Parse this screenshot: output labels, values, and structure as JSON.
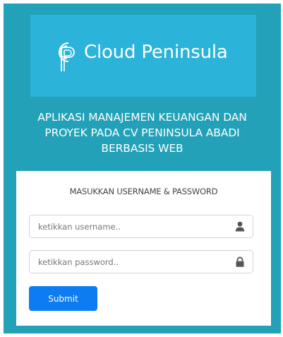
{
  "logo": {
    "brand_name": "Cloud Peninsula",
    "mark_icon": "cloud-peninsula-logo-icon"
  },
  "app_title": {
    "line1": "APLIKASI MANAJEMEN KEUANGAN DAN",
    "line2": "PROYEK PADA CV PENINSULA ABADI",
    "line3": "BERBASIS WEB"
  },
  "login": {
    "heading": "MASUKKAN USERNAME & PASSWORD",
    "username": {
      "value": "",
      "placeholder": "ketikkan username..",
      "icon": "user-icon"
    },
    "password": {
      "value": "",
      "placeholder": "ketikkan password..",
      "icon": "lock-icon"
    },
    "submit_label": "Submit"
  },
  "colors": {
    "page_background": "#22a1b8",
    "logo_panel": "#2bb3d9",
    "button": "#0d7cf2"
  }
}
